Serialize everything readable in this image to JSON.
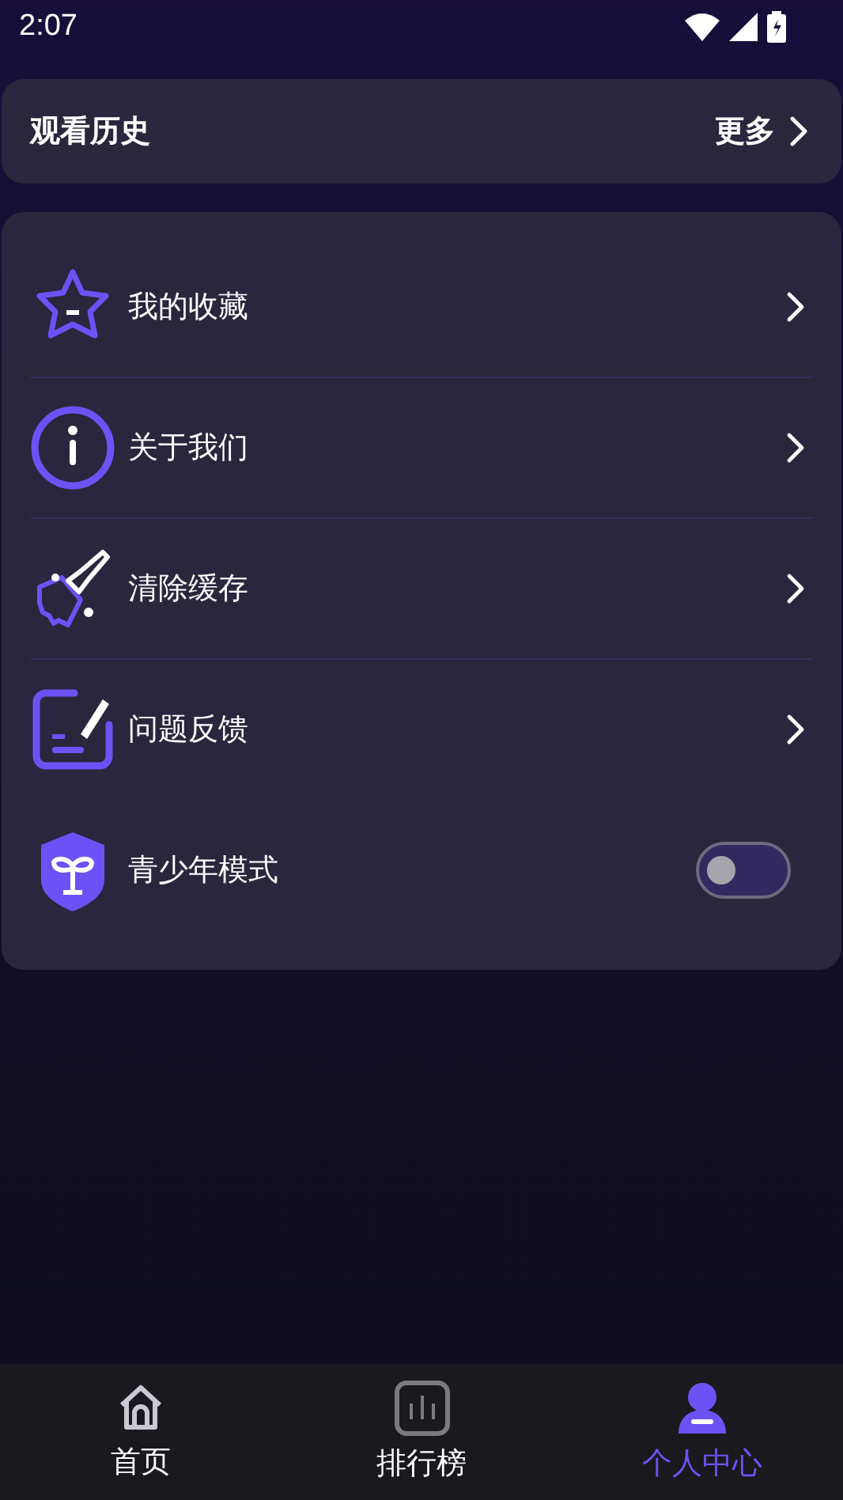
{
  "status_bar": {
    "time": "2:07"
  },
  "history": {
    "title": "观看历史",
    "more": "更多"
  },
  "menu": [
    {
      "kind": "link",
      "label": "我的收藏"
    },
    {
      "kind": "link",
      "label": "关于我们"
    },
    {
      "kind": "link",
      "label": "清除缓存"
    },
    {
      "kind": "link",
      "label": "问题反馈"
    },
    {
      "kind": "toggle",
      "label": "青少年模式",
      "on": false
    }
  ],
  "nav": [
    {
      "label": "首页",
      "selected": false
    },
    {
      "label": "排行榜",
      "selected": false
    },
    {
      "label": "个人中心",
      "selected": true
    }
  ]
}
